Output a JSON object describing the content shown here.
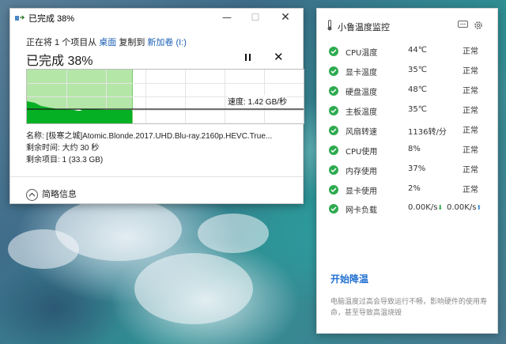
{
  "copy_dialog": {
    "title": "已完成 38%",
    "copy_line": {
      "prefix": "正在将 1 个项目从",
      "source": "桌面",
      "middle": "复制到",
      "dest": "新加卷 (I:)"
    },
    "progress_text": "已完成 38%",
    "progress_fraction": 0.38,
    "speed_label": "速度: 1.42 GB/秒",
    "name_line": "名称: [极寒之城]Atomic.Blonde.2017.UHD.Blu-ray.2160p.HEVC.True...",
    "time_line": "剩余时间: 大约 30 秒",
    "items_line": "剩余项目: 1 (33.3 GB)",
    "less_details": "简略信息",
    "accent_color": "#06b025"
  },
  "monitor": {
    "title": "小鲁温度监控",
    "rows": [
      {
        "name": "CPU温度",
        "value": "44℃",
        "status": "正常"
      },
      {
        "name": "显卡温度",
        "value": "35℃",
        "status": "正常"
      },
      {
        "name": "硬盘温度",
        "value": "48℃",
        "status": "正常"
      },
      {
        "name": "主板温度",
        "value": "35℃",
        "status": "正常"
      },
      {
        "name": "风扇转速",
        "value": "1136转/分",
        "status": "正常"
      },
      {
        "name": "CPU使用",
        "value": "8%",
        "status": "正常"
      },
      {
        "name": "内存使用",
        "value": "37%",
        "status": "正常"
      },
      {
        "name": "显卡使用",
        "value": "2%",
        "status": "正常"
      }
    ],
    "network": {
      "name": "网卡负载",
      "down": "0.00K/s",
      "up": "0.00K/s"
    },
    "cool_button": "开始降温",
    "note": "电脑温度过高会导致运行不畅，影响硬件的使用寿命，甚至导致高温烧毁",
    "ok_color": "#2daa4f",
    "link_color": "#1f6fd1"
  }
}
